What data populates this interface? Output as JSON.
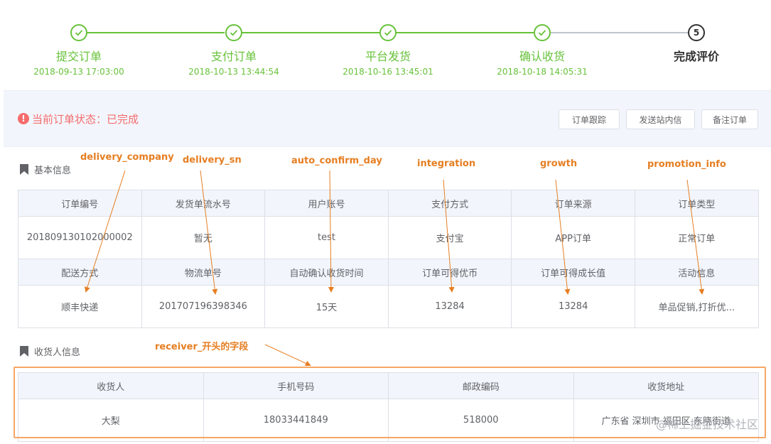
{
  "steps": [
    {
      "title": "提交订单",
      "time": "2018-09-13 17:03:00"
    },
    {
      "title": "支付订单",
      "time": "2018-10-13 13:44:54"
    },
    {
      "title": "平台发货",
      "time": "2018-10-16 13:45:01"
    },
    {
      "title": "确认收货",
      "time": "2018-10-18 14:05:31"
    },
    {
      "title": "完成评价",
      "step_number": "5"
    }
  ],
  "status": {
    "text": "当前订单状态：已完成",
    "buttons": {
      "track": "订单跟踪",
      "message": "发送站内信",
      "note": "备注订单"
    }
  },
  "basic_info": {
    "title": "基本信息",
    "headers1": [
      "订单编号",
      "发货单流水号",
      "用户账号",
      "支付方式",
      "订单来源",
      "订单类型"
    ],
    "values1": [
      "201809130102000002",
      "暂无",
      "test",
      "支付宝",
      "APP订单",
      "正常订单"
    ],
    "headers2": [
      "配送方式",
      "物流单号",
      "自动确认收货时间",
      "订单可得优币",
      "订单可得成长值",
      "活动信息"
    ],
    "values2": [
      "顺丰快递",
      "201707196398346",
      "15天",
      "13284",
      "13284",
      "单品促销,打折优..."
    ]
  },
  "receiver_info": {
    "title": "收货人信息",
    "headers": [
      "收货人",
      "手机号码",
      "邮政编码",
      "收货地址"
    ],
    "values": [
      "大梨",
      "18033441849",
      "518000",
      "广东省 深圳市 福田区 东晓街道"
    ]
  },
  "annotations": {
    "delivery_company": "delivery_company",
    "delivery_sn": "delivery_sn",
    "auto_confirm_day": "auto_confirm_day",
    "integration": "integration",
    "growth": "growth",
    "promotion_info": "promotion_info",
    "receiver": "receiver_开头的字段"
  },
  "watermark": "@稀土掘金技术社区",
  "colors": {
    "done": "#67c23a",
    "danger": "#f56c6c",
    "annotation": "#e67e22"
  }
}
